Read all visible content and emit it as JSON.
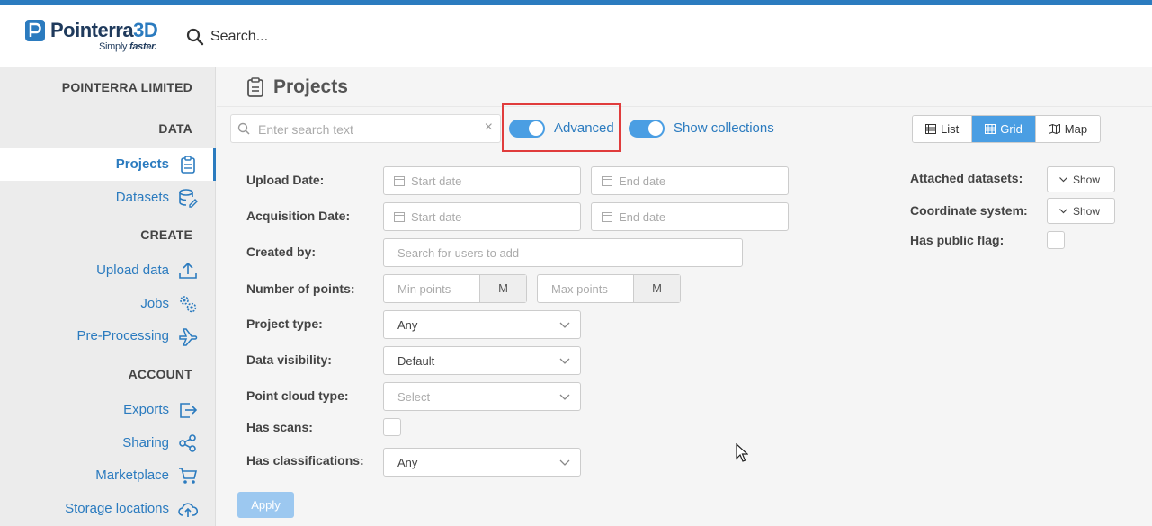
{
  "brand": {
    "name_part1": "Pointerra",
    "name_part2": "3D",
    "tagline_part1": "Simply ",
    "tagline_part2": "faster."
  },
  "header": {
    "search_placeholder": "Search..."
  },
  "sidebar": {
    "org": "POINTERRA LIMITED",
    "sections": {
      "data": "DATA",
      "create": "CREATE",
      "account": "ACCOUNT"
    },
    "items": [
      {
        "label": "Projects",
        "icon": "clipboard-icon",
        "active": true
      },
      {
        "label": "Datasets",
        "icon": "database-icon"
      },
      {
        "label": "Upload data",
        "icon": "upload-icon"
      },
      {
        "label": "Jobs",
        "icon": "gears-icon"
      },
      {
        "label": "Pre-Processing",
        "icon": "plane-icon"
      },
      {
        "label": "Exports",
        "icon": "export-icon"
      },
      {
        "label": "Sharing",
        "icon": "share-icon"
      },
      {
        "label": "Marketplace",
        "icon": "cart-icon"
      },
      {
        "label": "Storage locations",
        "icon": "cloud-upload-icon"
      }
    ]
  },
  "page": {
    "title": "Projects"
  },
  "toolbar": {
    "search_placeholder": "Enter search text",
    "clear": "×",
    "advanced_label": "Advanced",
    "advanced_on": true,
    "collections_label": "Show collections",
    "collections_on": true,
    "views": {
      "list": "List",
      "grid": "Grid",
      "map": "Map",
      "selected": "Grid"
    }
  },
  "filters": {
    "upload_date": {
      "label": "Upload Date:",
      "start": "Start date",
      "end": "End date"
    },
    "acquisition_date": {
      "label": "Acquisition Date:",
      "start": "Start date",
      "end": "End date"
    },
    "created_by": {
      "label": "Created by:",
      "placeholder": "Search for users to add"
    },
    "points": {
      "label": "Number of points:",
      "min": "Min points",
      "max": "Max points",
      "unit": "M"
    },
    "project_type": {
      "label": "Project type:",
      "value": "Any"
    },
    "data_visibility": {
      "label": "Data visibility:",
      "value": "Default"
    },
    "point_cloud_type": {
      "label": "Point cloud type:",
      "placeholder": "Select"
    },
    "has_scans": {
      "label": "Has scans:"
    },
    "has_classifications": {
      "label": "Has classifications:",
      "value": "Any"
    },
    "attached_datasets": {
      "label": "Attached datasets:",
      "button": "Show"
    },
    "coordinate_system": {
      "label": "Coordinate system:",
      "button": "Show"
    },
    "public_flag": {
      "label": "Has public flag:"
    },
    "apply": "Apply"
  },
  "colors": {
    "accent": "#2b7bbf",
    "toggle": "#4a9ee3",
    "highlight": "#e03c3c"
  }
}
